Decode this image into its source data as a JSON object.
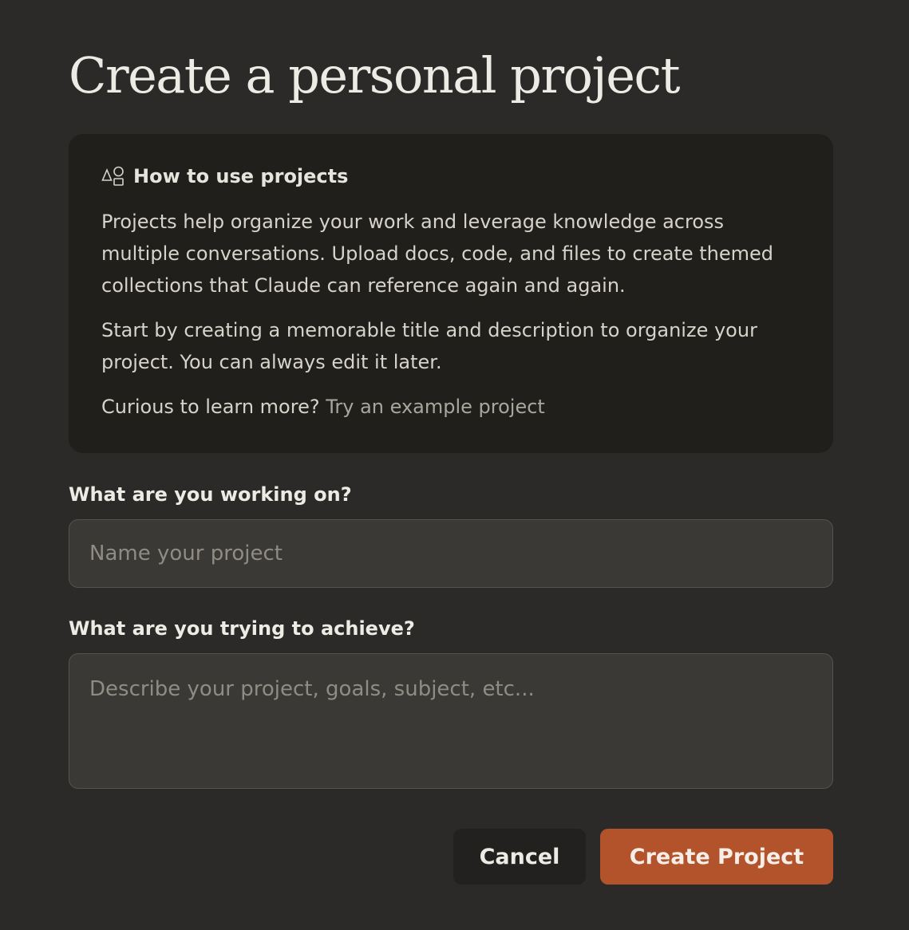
{
  "page": {
    "title": "Create a personal project"
  },
  "info": {
    "icon": "shapes-icon",
    "heading": "How to use projects",
    "paragraph1": "Projects help organize your work and leverage knowledge across multiple conversations. Upload docs, code, and files to create themed collections that Claude can reference again and again.",
    "paragraph2": "Start by creating a memorable title and description to organize your project. You can always edit it later.",
    "curious_text": "Curious to learn more?",
    "example_link": "Try an example project"
  },
  "form": {
    "name_label": "What are you working on?",
    "name_placeholder": "Name your project",
    "name_value": "",
    "description_label": "What are you trying to achieve?",
    "description_placeholder": "Describe your project, goals, subject, etc...",
    "description_value": ""
  },
  "actions": {
    "cancel_label": "Cancel",
    "create_label": "Create Project"
  },
  "colors": {
    "background": "#2b2a28",
    "card": "#201f1c",
    "accent": "#b2532c"
  }
}
